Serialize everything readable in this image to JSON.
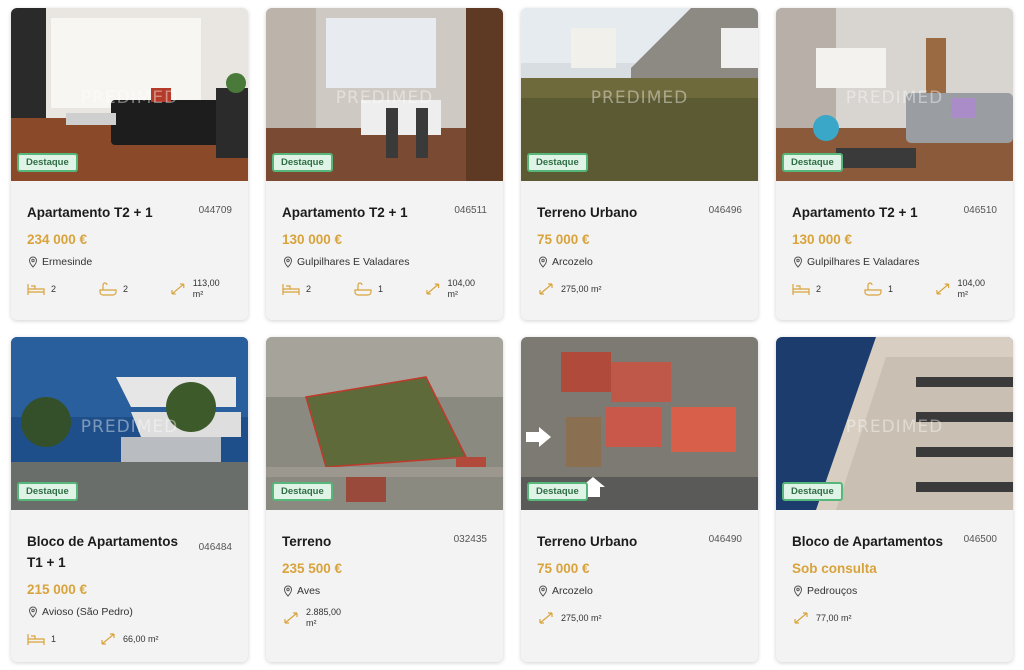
{
  "watermark": "PREDIMED",
  "badge_label": "Destaque",
  "colors": {
    "price": "#d9a33c",
    "badge_border": "#57b77a",
    "icon": "#d9a33c"
  },
  "listings": [
    {
      "title": "Apartamento T2 + 1",
      "ref": "044709",
      "price": "234 000 €",
      "location": "Ermesinde",
      "beds": "2",
      "baths": "2",
      "area": "113,00 m²",
      "badge": true
    },
    {
      "title": "Apartamento T2 + 1",
      "ref": "046511",
      "price": "130 000 €",
      "location": "Gulpilhares E Valadares",
      "beds": "2",
      "baths": "1",
      "area": "104,00 m²",
      "badge": true
    },
    {
      "title": "Terreno Urbano",
      "ref": "046496",
      "price": "75 000 €",
      "location": "Arcozelo",
      "area": "275,00 m²",
      "badge": true
    },
    {
      "title": "Apartamento T2 + 1",
      "ref": "046510",
      "price": "130 000 €",
      "location": "Gulpilhares E Valadares",
      "beds": "2",
      "baths": "1",
      "area": "104,00 m²",
      "badge": true
    },
    {
      "title": "Bloco de Apartamentos T1 + 1",
      "ref": "046484",
      "price": "215 000 €",
      "location": "Avioso (São Pedro)",
      "beds": "1",
      "area": "66,00 m²",
      "badge": true
    },
    {
      "title": "Terreno",
      "ref": "032435",
      "price": "235 500 €",
      "location": "Aves",
      "area": "2.885,00 m²",
      "badge": true
    },
    {
      "title": "Terreno Urbano",
      "ref": "046490",
      "price": "75 000 €",
      "location": "Arcozelo",
      "area": "275,00 m²",
      "badge": true
    },
    {
      "title": "Bloco de Apartamentos",
      "ref": "046500",
      "price": "Sob consulta",
      "location": "Pedrouços",
      "area": "77,00 m²",
      "badge": true
    }
  ]
}
